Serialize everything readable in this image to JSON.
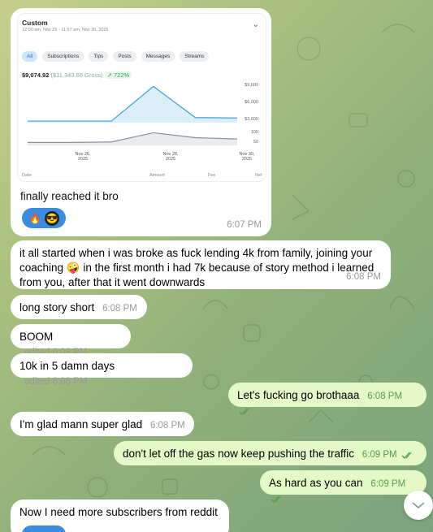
{
  "card": {
    "title": "Custom",
    "subtitle": "12:00 am, Nov 25 - 11:57 am, Nov 30, 2025",
    "tabs": [
      "All",
      "Subscriptions",
      "Tips",
      "Posts",
      "Messages",
      "Streams"
    ],
    "net": "$9,074.92",
    "gross": "($11,343.66 Gross)",
    "change": "↗ 722%",
    "columns": [
      "Date",
      "Amount",
      "Fee",
      "Net"
    ],
    "caption": "finally reached it bro",
    "time": "6:07 PM",
    "reactions": [
      "fire-emoji",
      "sunglasses-avatar"
    ]
  },
  "chart_data": [
    {
      "type": "area",
      "x": [
        "Nov 25, 2025",
        "Nov 26, 2025",
        "Nov 27, 2025",
        "Nov 28, 2025",
        "Nov 29, 2025",
        "Nov 30, 2025"
      ],
      "xticks": [
        "Nov 26,\n2025",
        "Nov 28,\n2025",
        "Nov 30,\n2025"
      ],
      "values": [
        400,
        400,
        400,
        9300,
        1300,
        1200
      ],
      "yticks": [
        "$9,600",
        "$6,000",
        "$3,600"
      ],
      "ylim": [
        0,
        10000
      ],
      "color": "#3aa0e0"
    },
    {
      "type": "area",
      "x": [
        "Nov 25, 2025",
        "Nov 26, 2025",
        "Nov 27, 2025",
        "Nov 28, 2025",
        "Nov 29, 2025",
        "Nov 30, 2025"
      ],
      "values": [
        22,
        22,
        26,
        95,
        58,
        48
      ],
      "yticks": [
        "100",
        "50"
      ],
      "ylim": [
        0,
        110
      ],
      "color": "#8a8f99"
    }
  ],
  "messages": [
    {
      "text": "it all started when i was broke as fuck lending 4k from family, joining your coaching 🤪 in the first month i had 7k because of story method i learned from you, after that it went downwards",
      "time": "6:08 PM"
    },
    {
      "text": "long story short",
      "time": "6:08 PM"
    },
    {
      "text": "BOOM",
      "time": "edited 6:08 PM"
    },
    {
      "text": "10k in 5 damn days",
      "time": "edited 6:08 PM"
    },
    {
      "text": "Let's fucking go brothaaa",
      "time": "6:08 PM"
    },
    {
      "text": "I'm glad mann super glad",
      "time": "6:08 PM"
    },
    {
      "text": "don't let off the gas now keep pushing the traffic",
      "time": "6:09 PM"
    },
    {
      "text": "As hard as you can",
      "time": "6:09 PM"
    },
    {
      "text": "Now I need more subscribers from reddit",
      "time": ""
    }
  ],
  "colors": {
    "incoming": "#ffffff",
    "outgoing": "#e5f9c8",
    "read_tick": "#55a04a"
  }
}
